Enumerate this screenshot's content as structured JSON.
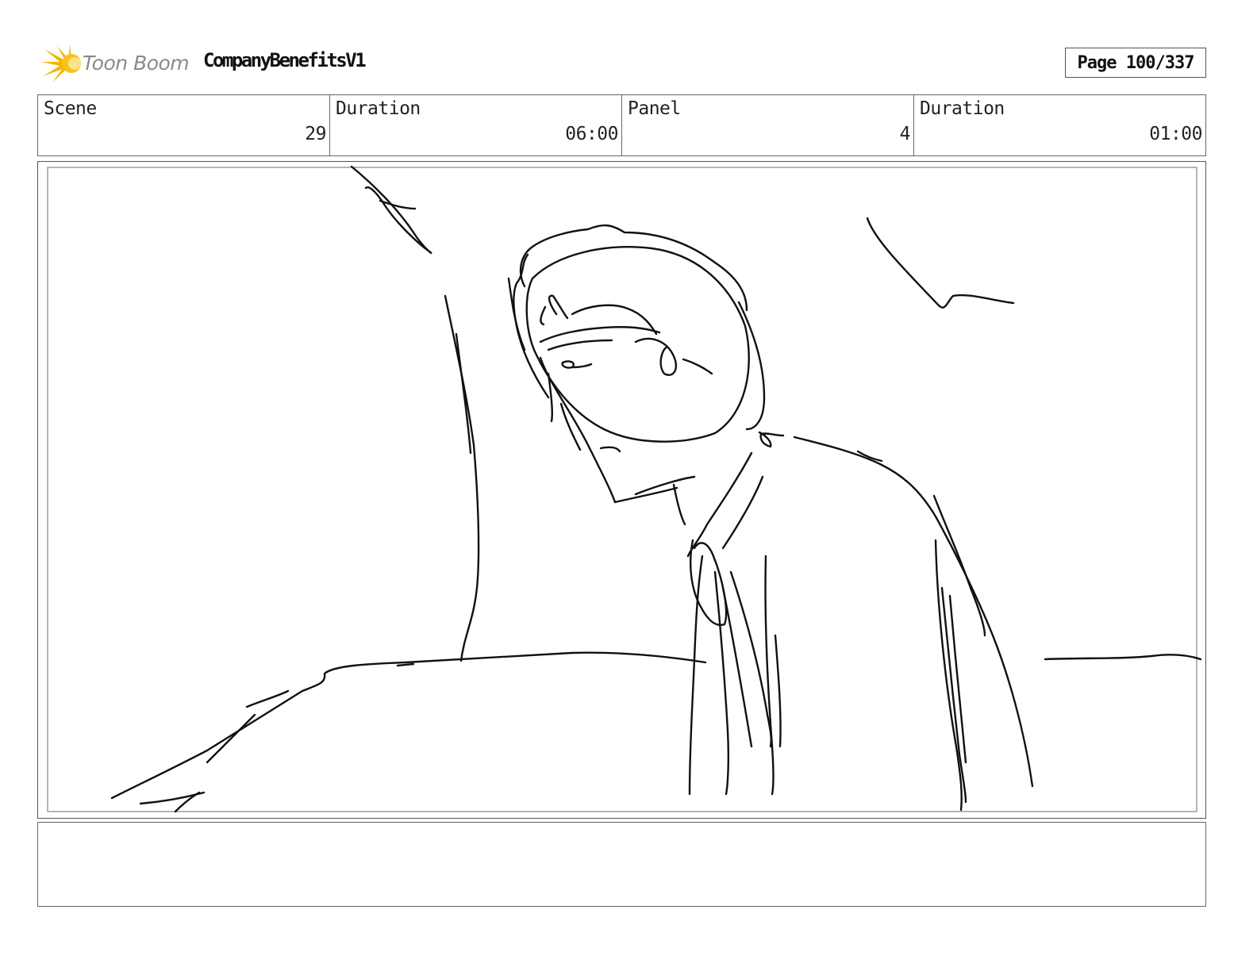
{
  "header": {
    "logo_text": "Toon Boom",
    "project_title": "CompanyBenefitsV1",
    "page_label": "Page 100/337"
  },
  "info": {
    "scene_label": "Scene",
    "scene_value": "29",
    "scene_duration_label": "Duration",
    "scene_duration_value": "06:00",
    "panel_label": "Panel",
    "panel_value": "4",
    "panel_duration_label": "Duration",
    "panel_duration_value": "01:00"
  },
  "notes": {
    "text": ""
  },
  "colors": {
    "logo_star": "#f2b705",
    "logo_text": "#8a8a8a",
    "border": "#666666"
  }
}
